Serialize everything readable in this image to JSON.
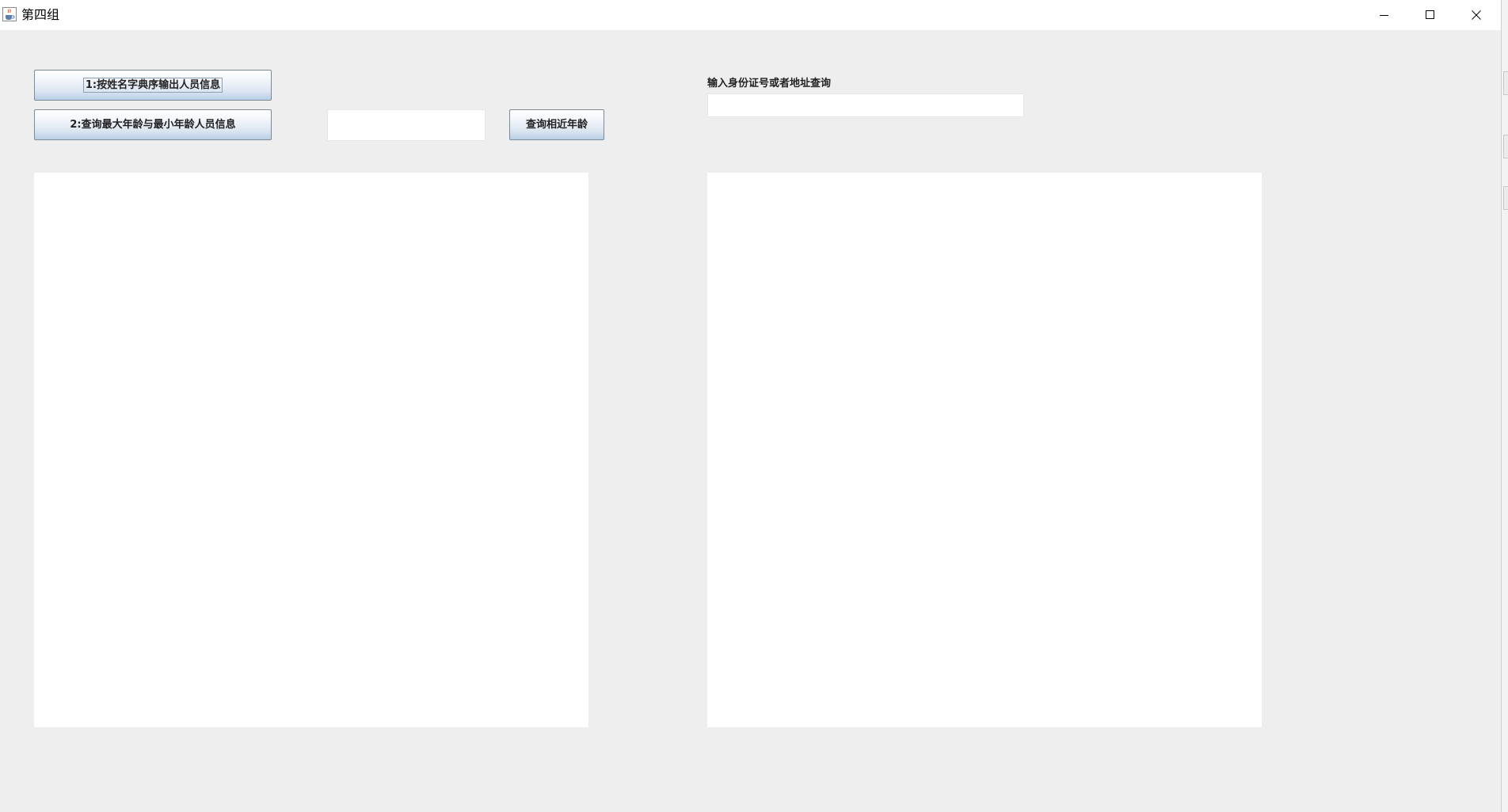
{
  "window": {
    "title": "第四组",
    "icon": "java-cup-icon",
    "controls": [
      "minimize-icon",
      "maximize-icon",
      "close-icon"
    ]
  },
  "buttons": {
    "sort_by_name": "1:按姓名字典序输出人员信息",
    "max_min_age": "2:查询最大年龄与最小年龄人员信息",
    "similar_age": "查询相近年龄"
  },
  "age_input": {
    "value": ""
  },
  "query": {
    "label": "输入身份证号或者地址查询",
    "value": ""
  },
  "left_output": {
    "text": ""
  },
  "right_output": {
    "text": ""
  }
}
